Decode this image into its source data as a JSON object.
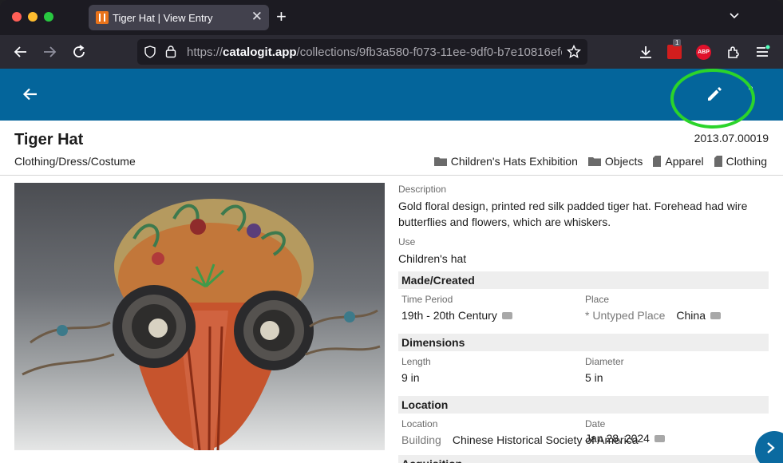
{
  "browser": {
    "tab_title": "Tiger Hat | View Entry",
    "tab_close": "✕",
    "new_tab": "+",
    "url_scheme": "https://",
    "url_host": "catalogit.app",
    "url_path": "/collections/9fb3a580-f073-11ee-9df0-b7e10816efc",
    "abp_label": "ABP",
    "badge_count": "1"
  },
  "entry": {
    "title": "Tiger Hat",
    "subtitle": "Clothing/Dress/Costume",
    "id": "2013.07.00019",
    "tags": [
      {
        "label": "Children's Hats Exhibition",
        "kind": "folder"
      },
      {
        "label": "Objects",
        "kind": "folder"
      },
      {
        "label": "Apparel",
        "kind": "file"
      },
      {
        "label": "Clothing",
        "kind": "file"
      }
    ]
  },
  "details": {
    "description_label": "Description",
    "description": "Gold floral design, printed red silk padded tiger hat. Forehead had wire butterflies and flowers, which are whiskers.",
    "use_label": "Use",
    "use": "Children's hat",
    "made": {
      "heading": "Made/Created",
      "period_label": "Time Period",
      "period": "19th - 20th Century",
      "place_label": "Place",
      "place_type": "* Untyped Place",
      "place": "China"
    },
    "dimensions": {
      "heading": "Dimensions",
      "length_label": "Length",
      "length": "9 in",
      "diameter_label": "Diameter",
      "diameter": "5 in"
    },
    "location": {
      "heading": "Location",
      "location_label": "Location",
      "location_type": "Building",
      "location": "Chinese Historical Society of America",
      "date_label": "Date",
      "date": "Jan 28, 2024"
    },
    "acquisition_heading": "Acquisition"
  },
  "colors": {
    "app_bar": "#04659b",
    "highlight": "#2bd42b"
  }
}
